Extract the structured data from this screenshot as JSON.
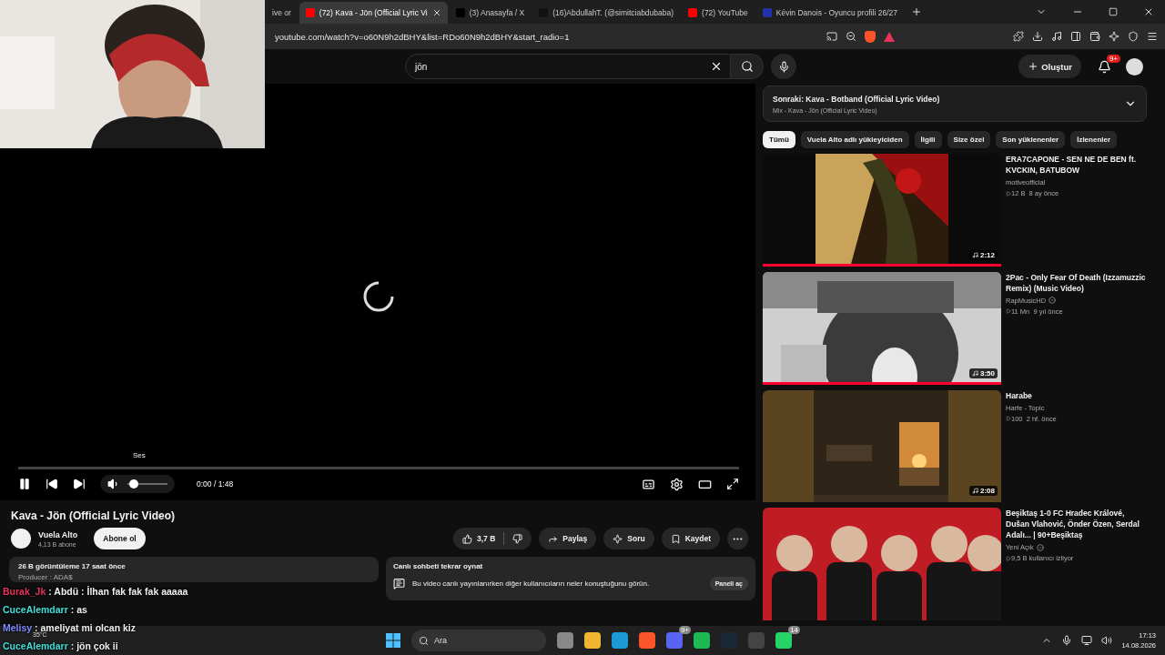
{
  "browser": {
    "tabs": [
      {
        "title": "ive or",
        "kind": "plain",
        "selected": false
      },
      {
        "title": "(72) Kava - Jön (Official Lyric Vi",
        "kind": "youtube",
        "selected": true
      },
      {
        "title": "(3) Anasayfa / X",
        "kind": "x",
        "selected": false
      },
      {
        "title": "(16)AbdullahT. (@simitciabdubaba)",
        "kind": "tiktok",
        "selected": false
      },
      {
        "title": "(72) YouTube",
        "kind": "youtube",
        "selected": false
      },
      {
        "title": "Kévin Danois - Oyuncu profili 26/27",
        "kind": "site",
        "selected": false
      }
    ],
    "address": "youtube.com/watch?v=o60N9h2dBHY&list=RDo60N9h2dBHY&start_radio=1"
  },
  "header": {
    "search": "jön",
    "create": "Oluştur",
    "notifications": "9+"
  },
  "player": {
    "loading": true,
    "playing": true,
    "tooltip": "Ses",
    "time": "0:00 / 1:48",
    "progress": {
      "level": 0
    },
    "volume": {
      "level": 0.15
    }
  },
  "video": {
    "title": "Kava - Jön (Official Lyric Video)",
    "channel": "Vuela Alto",
    "subscribers": "4,13 B abone",
    "subscribe": "Abone ol",
    "likes": "3,7 B",
    "actions": [
      {
        "kind": "share",
        "label": "Paylaş"
      },
      {
        "kind": "ask",
        "label": "Soru"
      },
      {
        "kind": "save",
        "label": "Kaydet"
      }
    ]
  },
  "description": {
    "stats": "26 B görüntüleme  17 saat önce",
    "lines": [
      "Producer : ADA$"
    ]
  },
  "chat_replay": {
    "title": "Canlı sohbeti tekrar oynat",
    "text": "Bu video canlı yayınlanırken diğer kullanıcıların neler konuştuğunu görün.",
    "button": "Paneli aç"
  },
  "up_next": {
    "title": "Sonraki: Kava - Botband (Official Lyric Video)",
    "subtitle": "Mix - Kava - Jön (Official Lyric Video)"
  },
  "chips": [
    {
      "label": "Tümü",
      "selected": true
    },
    {
      "label": "Vuela Alto adlı yükleyiciden",
      "selected": false
    },
    {
      "label": "İlgili",
      "selected": false
    },
    {
      "label": "Size özel",
      "selected": false
    },
    {
      "label": "Son yüklenenler",
      "selected": false
    },
    {
      "label": "İzlenenler",
      "selected": false
    }
  ],
  "videos": [
    {
      "kind": "dark",
      "title": "ERA7CAPONE - SEN NE DE BEN ft. KVCKIN, BATUBOW",
      "channel": "motiveofficial",
      "verified": false,
      "meta": "12 B  8 ay önce",
      "duration": "2:12",
      "watched": true
    },
    {
      "kind": "mono",
      "title": "2Pac - Only Fear Of Death (Izzamuzzic Remix) (Music Video)",
      "channel": "RapMusicHD",
      "verified": true,
      "meta": "11 Mn  9 yıl önce",
      "duration": "3:50",
      "watched": true
    },
    {
      "kind": "room",
      "title": "Harabe",
      "channel": "Harfe - Topic",
      "verified": false,
      "meta": "100  2 hf. önce",
      "duration": "2:08",
      "watched": false
    },
    {
      "kind": "crowd",
      "title": "Beşiktaş 1-0 FC Hradec Králové, Dušan Vlahović, Önder Özen, Serdal Adalı... | 90+Beşiktaş",
      "channel": "Yeni Açık",
      "verified": true,
      "meta": "9,5 B kullanıcı izliyor",
      "watched": false
    }
  ],
  "chat": [
    {
      "name": "Burak_Jk",
      "text": ": Abdü : İlhan fak fak fak aaaaa",
      "color": "#e8345a"
    },
    {
      "name": "CuceAlemdarr",
      "text": ": as",
      "color": "#3ee0d8"
    },
    {
      "name": "Melisy",
      "text": ": ameliyat mi olcan kiz",
      "color": "#7c8cff"
    },
    {
      "name": "CuceAlemdarr",
      "text": ": jön çok ii",
      "color": "#3ee0d8"
    }
  ],
  "taskbar": {
    "weather": "35°C",
    "search": "Ara",
    "apps": [
      {
        "kind": "files"
      },
      {
        "kind": "folder"
      },
      {
        "kind": "edge"
      },
      {
        "kind": "brave"
      },
      {
        "kind": "discord",
        "badge": "9+"
      },
      {
        "kind": "spotify"
      },
      {
        "kind": "steam"
      },
      {
        "kind": "chrome"
      },
      {
        "kind": "whatsapp",
        "badge": "14"
      }
    ],
    "time": "17:13",
    "date": "14.08.2026"
  }
}
